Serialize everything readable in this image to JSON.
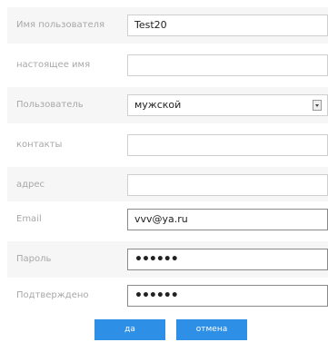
{
  "fields": {
    "username": {
      "label": "Имя пользователя",
      "value": "Test20"
    },
    "realname": {
      "label": "настоящее имя",
      "value": ""
    },
    "gender": {
      "label": "Пользователь",
      "value": "мужской"
    },
    "contacts": {
      "label": "контакты",
      "value": ""
    },
    "address": {
      "label": "адрес",
      "value": ""
    },
    "email": {
      "label": "Email",
      "value": "vvv@ya.ru"
    },
    "password": {
      "label": "Пароль",
      "value": "••••••"
    },
    "confirm": {
      "label": "Подтверждено",
      "value": "••••••"
    }
  },
  "buttons": {
    "ok": "да",
    "cancel": "отмена"
  },
  "colors": {
    "button": "#2d8fe6",
    "row_alt": "#f6f6f6"
  }
}
